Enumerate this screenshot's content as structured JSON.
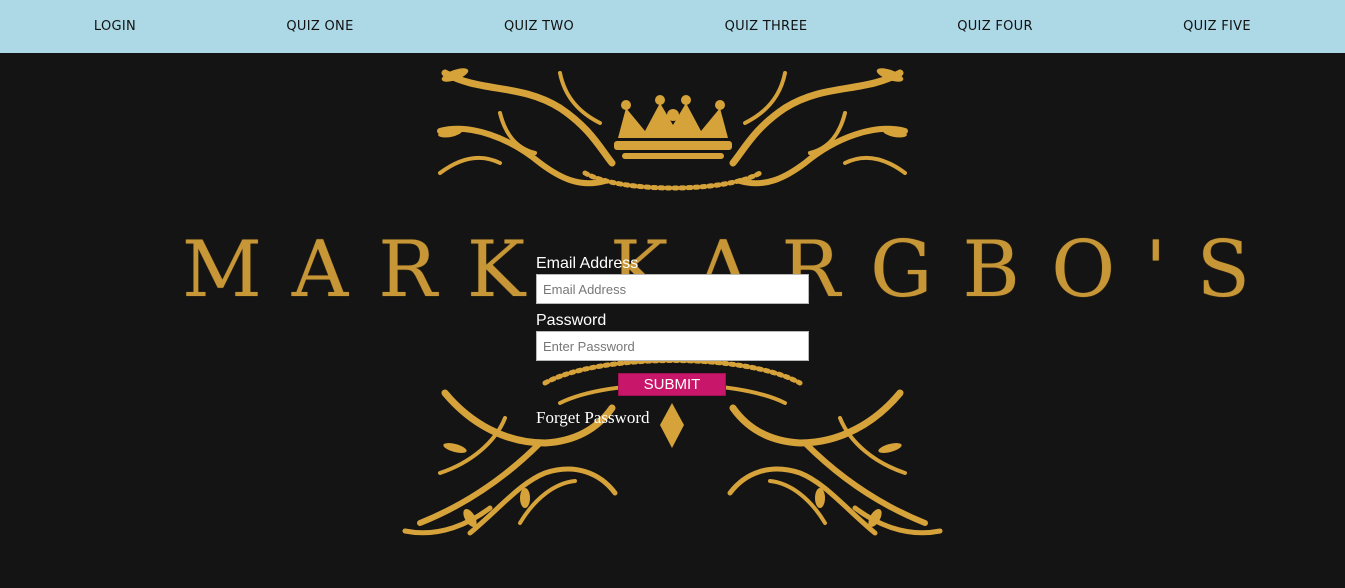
{
  "nav": {
    "items": [
      {
        "label": "LOGIN"
      },
      {
        "label": "QUIZ ONE"
      },
      {
        "label": "QUIZ TWO"
      },
      {
        "label": "QUIZ THREE"
      },
      {
        "label": "QUIZ FOUR"
      },
      {
        "label": "QUIZ FIVE"
      }
    ]
  },
  "background": {
    "brand_text": "MARK KARGBO'S",
    "emblem_icon": "crown-icon",
    "ornament_icon": "gold-flourish-ornament",
    "gold_color": "#d6a23a",
    "bg_color": "#141414"
  },
  "form": {
    "email_label": "Email Address",
    "email_placeholder": "Email Address",
    "email_value": "",
    "password_label": "Password",
    "password_placeholder": "Enter Password",
    "password_value": "",
    "submit_label": "SUBMIT",
    "forget_label": "Forget Password",
    "submit_color": "#c8166a"
  },
  "colors": {
    "nav_bg": "#add8e6"
  }
}
